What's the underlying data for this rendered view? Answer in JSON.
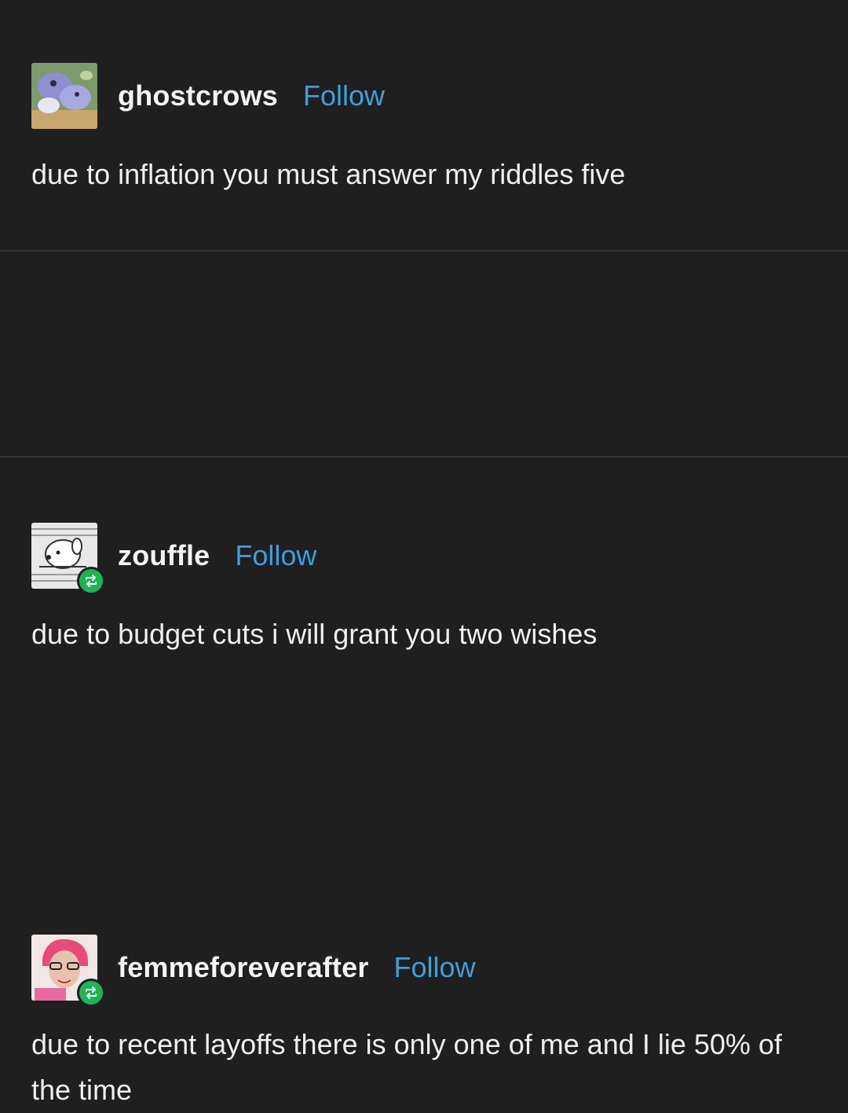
{
  "posts": [
    {
      "username": "ghostcrows",
      "follow_label": "Follow",
      "text": "due to inflation you must answer my riddles five",
      "avatar_icon": "plush-toys-avatar",
      "reblog": false
    },
    {
      "username": "zouffle",
      "follow_label": "Follow",
      "text": "due to budget cuts i will grant you two wishes",
      "avatar_icon": "dog-sketch-avatar",
      "reblog": true
    },
    {
      "username": "femmeforeverafter",
      "follow_label": "Follow",
      "text": "due to recent layoffs there is only one of me and I lie 50% of the time",
      "avatar_icon": "person-pink-hair-avatar",
      "reblog": true
    }
  ],
  "colors": {
    "background": "#1f1f20",
    "follow_link": "#3f9fd9",
    "reblog_badge": "#1cb554"
  }
}
